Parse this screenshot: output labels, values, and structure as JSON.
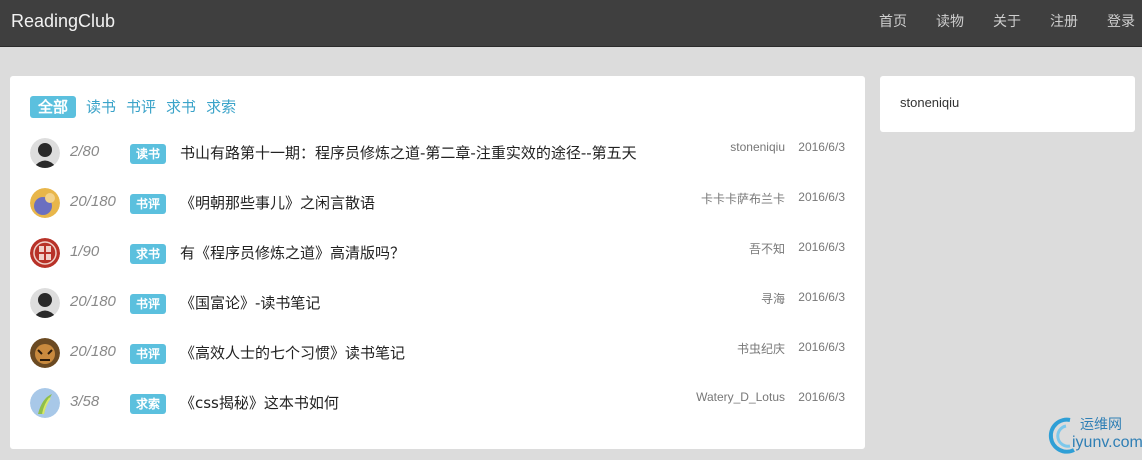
{
  "navbar": {
    "brand": "ReadingClub",
    "links": [
      "首页",
      "读物",
      "关于",
      "注册",
      "登录"
    ]
  },
  "tabs": [
    {
      "label": "全部",
      "active": true
    },
    {
      "label": "读书",
      "active": false
    },
    {
      "label": "书评",
      "active": false
    },
    {
      "label": "求书",
      "active": false
    },
    {
      "label": "求索",
      "active": false
    }
  ],
  "topics": [
    {
      "count": "2/80",
      "tag": "读书",
      "title": "书山有路第十一期：程序员修炼之道-第二章-注重实效的途径--第五天",
      "author": "stoneniqiu",
      "date": "2016/6/3",
      "avatar_color": "#2a2a2a"
    },
    {
      "count": "20/180",
      "tag": "书评",
      "title": "《明朝那些事儿》之闲言散语",
      "author": "卡卡卡萨布兰卡",
      "date": "2016/6/3",
      "avatar_color": "#7b7fc8"
    },
    {
      "count": "1/90",
      "tag": "求书",
      "title": "有《程序员修炼之道》高清版吗？",
      "author": "吾不知",
      "date": "2016/6/3",
      "avatar_color": "#c0392b"
    },
    {
      "count": "20/180",
      "tag": "书评",
      "title": "《国富论》-读书笔记",
      "author": "寻海",
      "date": "2016/6/3",
      "avatar_color": "#2a2a2a"
    },
    {
      "count": "20/180",
      "tag": "书评",
      "title": "《高效人士的七个习惯》读书笔记",
      "author": "书虫纪庆",
      "date": "2016/6/3",
      "avatar_color": "#8a6a3a"
    },
    {
      "count": "3/58",
      "tag": "求索",
      "title": "《css揭秘》这本书如何",
      "author": "Watery_D_Lotus",
      "date": "2016/6/3",
      "avatar_color": "#9bbf5a"
    }
  ],
  "sidebar": {
    "username": "stoneniqiu"
  },
  "watermark": {
    "line1": "运维网",
    "line2": "iyunv.com"
  },
  "colors": {
    "navbar": "#3f3f3f",
    "accent": "#5bc0de",
    "link": "#3aa3c9"
  }
}
